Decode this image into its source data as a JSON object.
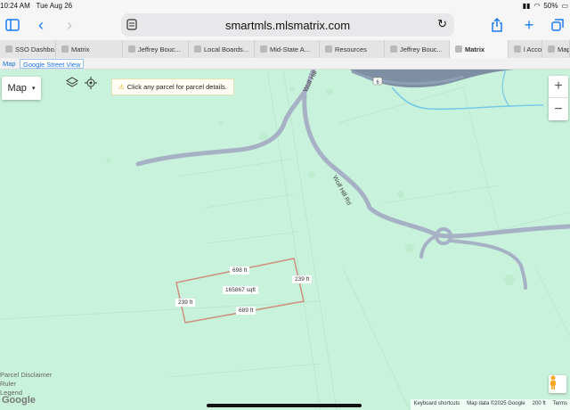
{
  "status": {
    "time": "10:24 AM",
    "date": "Tue Aug 26",
    "battery": "50%"
  },
  "browser": {
    "url": "smartmls.mlsmatrix.com"
  },
  "tabs": [
    {
      "label": "SSO Dashbo...",
      "width": 63
    },
    {
      "label": "Matrix",
      "width": 75
    },
    {
      "label": "Jeffrey Bouc...",
      "width": 74
    },
    {
      "label": "Local Boards...",
      "width": 74
    },
    {
      "label": "Mid-State A...",
      "width": 73
    },
    {
      "label": "Resources",
      "width": 73
    },
    {
      "label": "Jeffrey Bouc...",
      "width": 73
    },
    {
      "label": "Matrix",
      "width": 66,
      "active": true
    },
    {
      "label": "l Accou...",
      "width": 38
    },
    {
      "label": "Maps",
      "width": 31
    }
  ],
  "maptabs": {
    "map": "Map",
    "street": "Google Street View"
  },
  "map": {
    "type_label": "Map",
    "hint": "Click any parcel for parcel details.",
    "zoom_in": "+",
    "zoom_out": "−",
    "route_shield": "6",
    "road_labels": [
      "Wolf Hill",
      "Wolf Hill Rd"
    ],
    "dims": {
      "top": "698 ft",
      "right": "239 ft",
      "left": "239 ft",
      "bottom": "689 ft",
      "area": "165867 sqft"
    },
    "links": [
      "Parcel Disclaimer",
      "Ruler",
      "Legend"
    ],
    "google": "Google",
    "footer": [
      "Keyboard shortcuts",
      "Map data ©2025 Google",
      "200 ft",
      "Terms"
    ]
  }
}
